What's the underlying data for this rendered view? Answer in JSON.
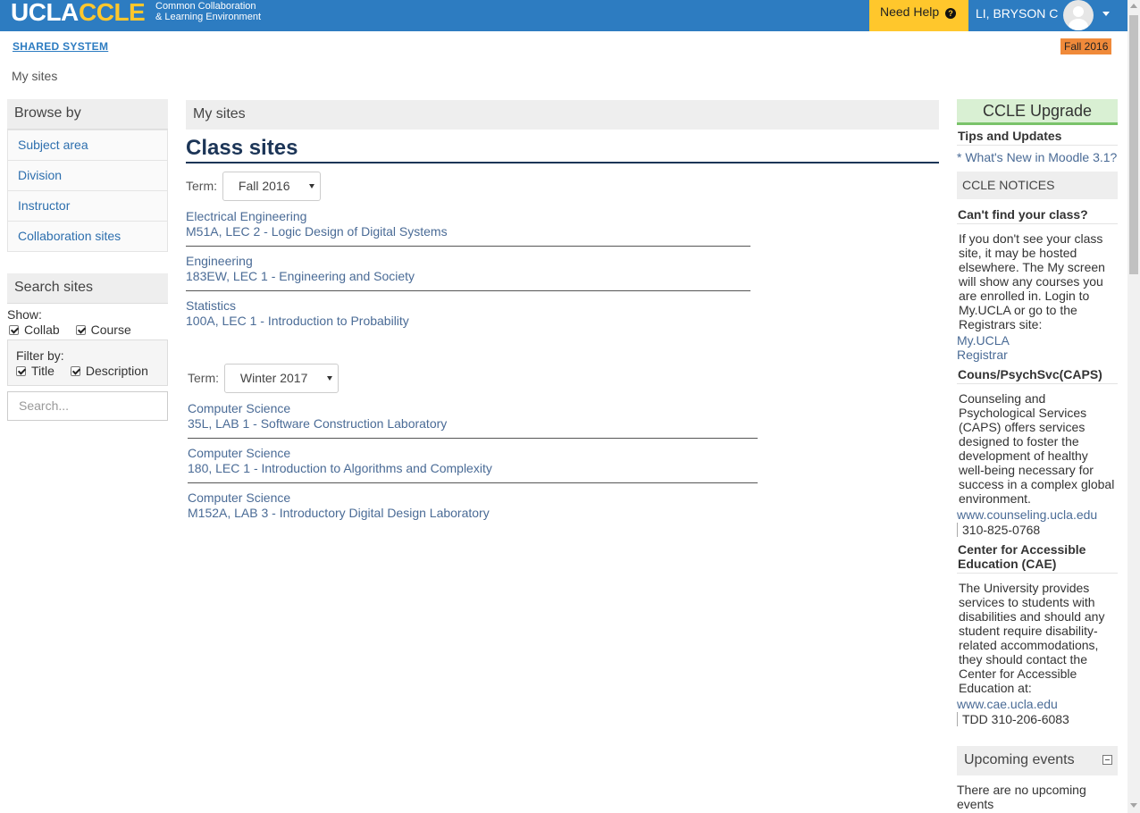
{
  "header": {
    "logo_ucla": "UCLA",
    "logo_ccle": "CCLE",
    "logo_sub_1": "Common Collaboration",
    "logo_sub_2": "& Learning Environment",
    "help_label": "Need Help",
    "user_name": "LI, BRYSON C",
    "colors": {
      "bar": "#2d7cc1",
      "accent": "#ffc72c"
    }
  },
  "system_link": "SHARED SYSTEM",
  "term_badge": "Fall 2016",
  "breadcrumb": "My sites",
  "left": {
    "browse_title": "Browse by",
    "browse_items": [
      "Subject area",
      "Division",
      "Instructor",
      "Collaboration sites"
    ],
    "search_title": "Search sites",
    "show_label": "Show:",
    "show_options": [
      "Collab",
      "Course"
    ],
    "filter_label": "Filter by:",
    "filter_options": [
      "Title",
      "Description"
    ],
    "search_placeholder": "Search..."
  },
  "main": {
    "header": "My sites",
    "title": "Class sites",
    "term_label": "Term:",
    "terms": [
      {
        "selected": "Fall 2016",
        "courses": [
          {
            "dept": "Electrical Engineering",
            "title": "M51A, LEC 2 - Logic Design of Digital Systems"
          },
          {
            "dept": "Engineering",
            "title": "183EW, LEC 1 - Engineering and Society"
          },
          {
            "dept": "Statistics",
            "title": "100A, LEC 1 - Introduction to Probability"
          }
        ]
      },
      {
        "selected": "Winter 2017",
        "courses": [
          {
            "dept": "Computer Science",
            "title": "35L, LAB 1 - Software Construction Laboratory"
          },
          {
            "dept": "Computer Science",
            "title": "180, LEC 1 - Introduction to Algorithms and Complexity"
          },
          {
            "dept": "Computer Science",
            "title": "M152A, LAB 3 - Introductory Digital Design Laboratory"
          }
        ]
      }
    ]
  },
  "right": {
    "upgrade_title": "CCLE Upgrade",
    "tips_title": "Tips and Updates",
    "tips_link": "* What's New in Moodle 3.1?",
    "notices_title": "CCLE NOTICES",
    "cant_find_title": "Can't find your class?",
    "cant_find_text": "If you don't see your class site, it may be hosted elsewhere. The My screen will show any courses you are enrolled in. Login to My.UCLA or go to the Registrars site:",
    "link_myucla": "My.UCLA",
    "link_registrar": "Registrar",
    "caps_title": "Couns/PsychSvc(CAPS)",
    "caps_text": "Counseling and Psychological Services (CAPS) offers services designed to foster the development of healthy well-being necessary for success in a complex global environment.",
    "caps_link": "www.counseling.ucla.edu",
    "caps_phone": "310-825-0768",
    "cae_title": "Center for Accessible Education (CAE)",
    "cae_text": "The University provides services to students with disabilities and should any student require disability-related accommodations, they should contact the Center for Accessible Education at:",
    "cae_link": "www.cae.ucla.edu",
    "cae_phone": "TDD 310-206-6083",
    "events_title": "Upcoming events",
    "events_text": "There are no upcoming events"
  }
}
